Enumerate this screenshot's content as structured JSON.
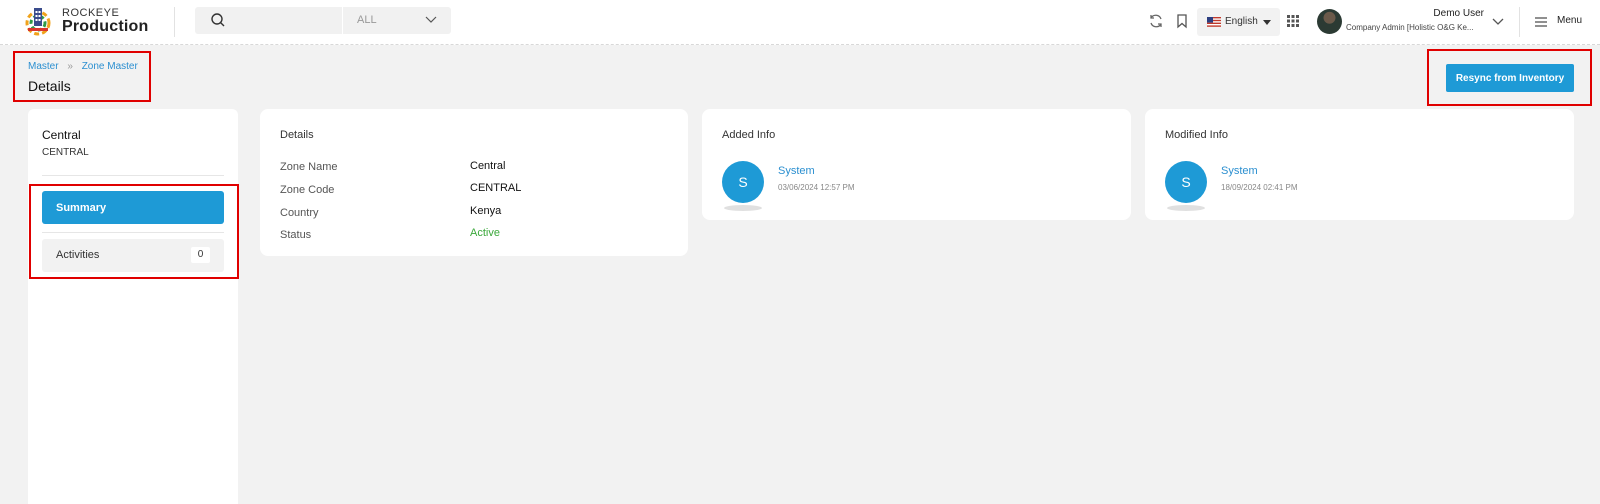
{
  "app": {
    "brand_top": "ROCKEYE",
    "brand_main": "Production"
  },
  "search": {
    "placeholder": "",
    "filter_value": "ALL"
  },
  "header": {
    "language": "English",
    "user_name": "Demo User",
    "user_role": "Company Admin [Holistic O&G Ke...",
    "menu_label": "Menu"
  },
  "breadcrumb": {
    "items": [
      "Master",
      "Zone Master"
    ],
    "title": "Details"
  },
  "actions": {
    "resync_label": "Resync from Inventory"
  },
  "sidebar": {
    "name": "Central",
    "code": "CENTRAL",
    "summary_label": "Summary",
    "activities_label": "Activities",
    "activities_count": "0"
  },
  "details": {
    "title": "Details",
    "rows": [
      {
        "label": "Zone Name",
        "value": "Central"
      },
      {
        "label": "Zone Code",
        "value": "CENTRAL"
      },
      {
        "label": "Country",
        "value": "Kenya"
      },
      {
        "label": "Status",
        "value": "Active"
      }
    ]
  },
  "added_info": {
    "title": "Added Info",
    "initial": "S",
    "user": "System",
    "timestamp": "03/06/2024 12:57 PM"
  },
  "modified_info": {
    "title": "Modified Info",
    "initial": "S",
    "user": "System",
    "timestamp": "18/09/2024 02:41 PM"
  },
  "colors": {
    "accent": "#1e9ad6",
    "link": "#2b8fd0",
    "status_active": "#3aa83a",
    "highlight_box": "#e00000"
  }
}
